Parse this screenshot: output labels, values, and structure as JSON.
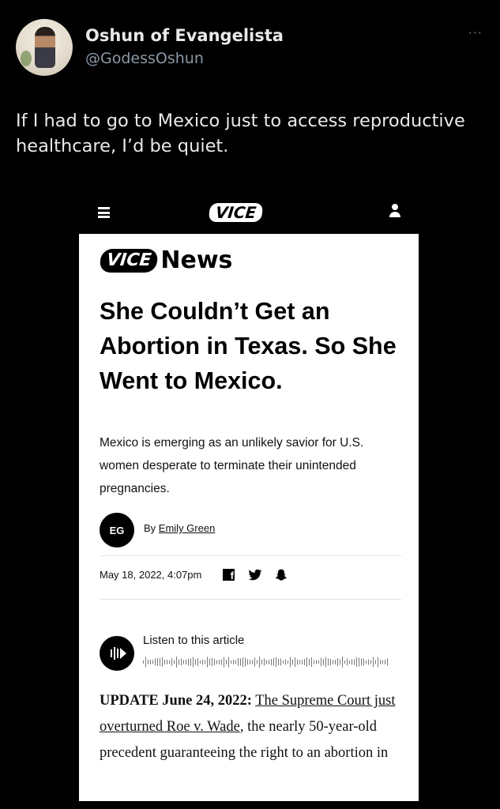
{
  "tweet": {
    "display_name": "Oshun of Evangelista",
    "handle": "@GodessOshun",
    "more_label": "···",
    "text": "If I had to go to Mexico just to access reproductive healthcare, I’d be quiet."
  },
  "article": {
    "site_logo": "VICE",
    "brand_logo": "VICE",
    "brand_word": "News",
    "headline": "She Couldn’t Get an Abortion in Texas. So She Went to Mexico.",
    "dek": "Mexico is emerging as an unlikely savior for U.S. women desperate to terminate their unintended pregnancies.",
    "author_initials": "EG",
    "byline_prefix": "By",
    "author_name": "Emily Green",
    "date": "May 18, 2022, 4:07pm",
    "share_icons": [
      "facebook-icon",
      "twitter-icon",
      "snapchat-icon"
    ],
    "listen_label": "Listen to this article",
    "update_label": "UPDATE June 24, 2022:",
    "update_link": "The Supreme Court just overturned Roe v. Wade",
    "update_rest": ", the nearly 50-year-old precedent guaranteeing the right to an abortion in"
  },
  "colors": {
    "background": "#000000",
    "card": "#ffffff",
    "text_primary": "#e7e9ea",
    "text_secondary": "#8b98a5"
  }
}
